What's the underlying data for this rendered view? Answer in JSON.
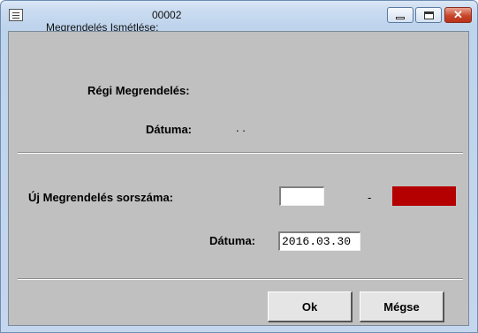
{
  "window": {
    "title": "Megrendelés Ismétlése:",
    "order_id": "00002",
    "minimize_label": "",
    "maximize_label": "",
    "close_label": "✕"
  },
  "old_order": {
    "label": "Régi Megrendelés:",
    "value": "",
    "date_label": "Dátuma:",
    "date_value": ". ."
  },
  "new_order": {
    "label": "Új Megrendelés sorszáma:",
    "number_value": "",
    "dash": "-",
    "status_color": "#b40000",
    "date_label": "Dátuma:",
    "date_value": "2016.03.30"
  },
  "buttons": {
    "ok": "Ok",
    "cancel": "Mégse"
  }
}
